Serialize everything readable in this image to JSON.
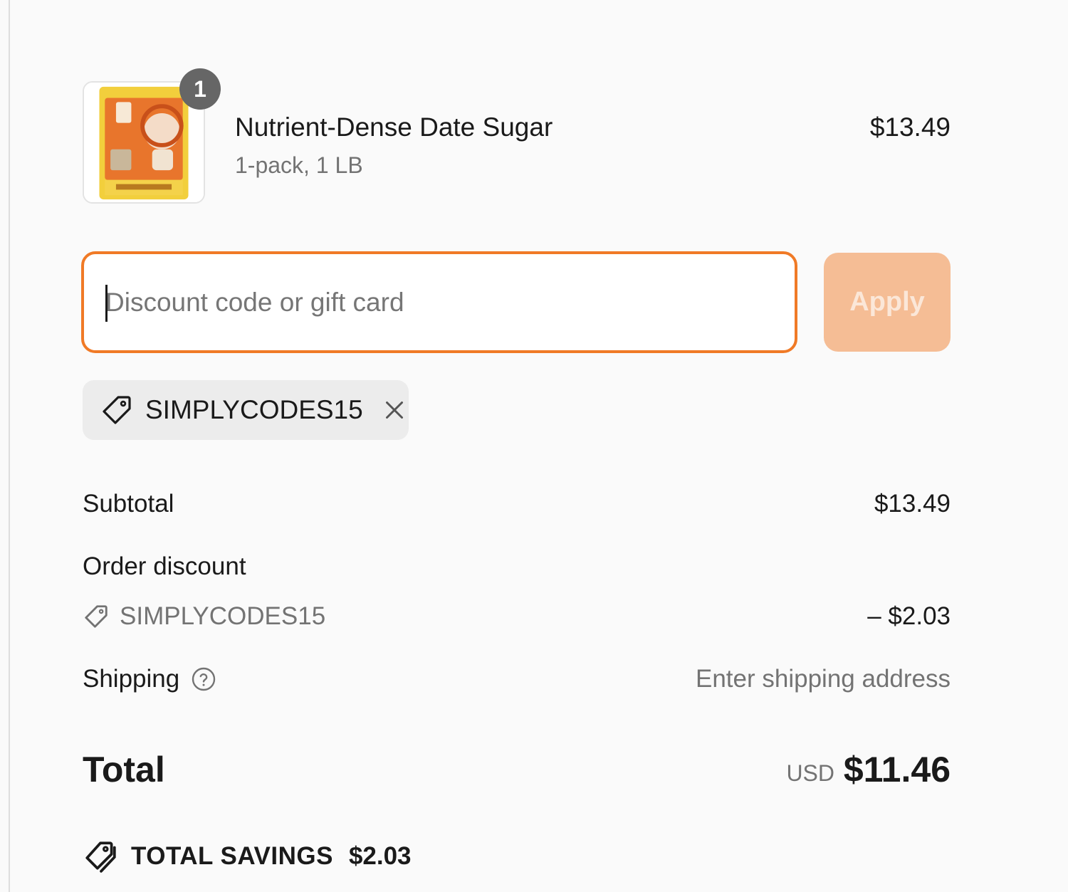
{
  "product": {
    "name": "Nutrient-Dense Date Sugar",
    "variant": "1-pack, 1 LB",
    "price": "$13.49",
    "quantity": "1",
    "image_icon": "product-bag-image"
  },
  "discount": {
    "placeholder": "Discount code or gift card",
    "value": "",
    "apply_label": "Apply",
    "applied_code": "SIMPLYCODES15"
  },
  "summary": {
    "subtotal_label": "Subtotal",
    "subtotal_value": "$13.49",
    "order_discount_label": "Order discount",
    "discount_code": "SIMPLYCODES15",
    "discount_value": "– $2.03",
    "shipping_label": "Shipping",
    "shipping_value": "Enter shipping address",
    "total_label": "Total",
    "total_currency": "USD",
    "total_value": "$11.46",
    "savings_label": "TOTAL SAVINGS",
    "savings_value": "$2.03"
  },
  "colors": {
    "accent": "#f07a26",
    "apply_disabled": "#f5bd95",
    "chip_bg": "#ececec",
    "page_bg": "#fafafa"
  }
}
